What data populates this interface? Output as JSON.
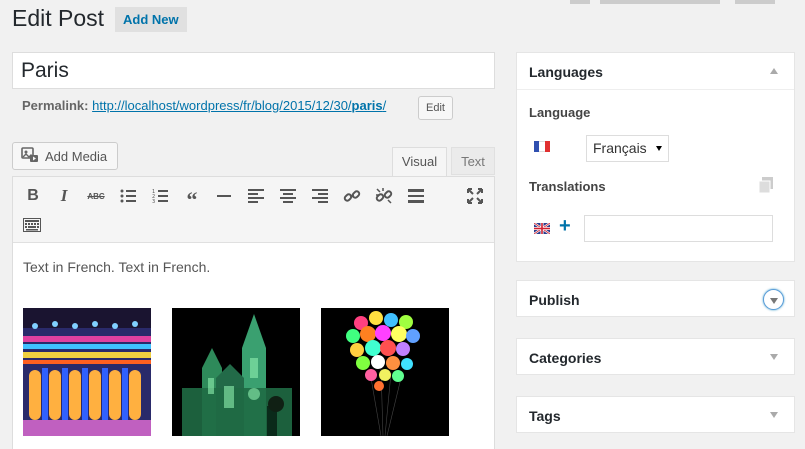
{
  "header": {
    "title": "Edit Post",
    "add_new_label": "Add New"
  },
  "post": {
    "title": "Paris",
    "permalink_label": "Permalink:",
    "permalink_base": "http://localhost/wordpress/fr/blog/2015/12/30/",
    "permalink_slug": "paris",
    "permalink_trailing": "/",
    "edit_slug_label": "Edit"
  },
  "editor": {
    "add_media_label": "Add Media",
    "tabs": [
      {
        "label": "Visual",
        "active": true
      },
      {
        "label": "Text",
        "active": false
      }
    ],
    "toolbar_icons": [
      "bold-icon",
      "italic-icon",
      "strikethrough-icon",
      "bullet-list-icon",
      "numbered-list-icon",
      "blockquote-icon",
      "horizontal-rule-icon",
      "align-left-icon",
      "align-center-icon",
      "align-right-icon",
      "link-icon",
      "unlink-icon",
      "read-more-icon",
      "fullscreen-icon",
      "toolbar-toggle-icon"
    ],
    "content_text": "Text in French. Text in French.",
    "images": [
      "illuminated-building-facade",
      "green-lit-cathedral",
      "colorful-balloons-at-night"
    ]
  },
  "sidebar": {
    "languages": {
      "title": "Languages",
      "language_label": "Language",
      "selected_language": "Français",
      "translations_label": "Translations",
      "translation_flag": "en-flag-icon",
      "translation_value": ""
    },
    "publish_title": "Publish",
    "categories_title": "Categories",
    "tags_title": "Tags"
  },
  "colors": {
    "accent": "#0073aa",
    "background": "#f1f1f1",
    "focus_ring": "#5b9dd9"
  }
}
